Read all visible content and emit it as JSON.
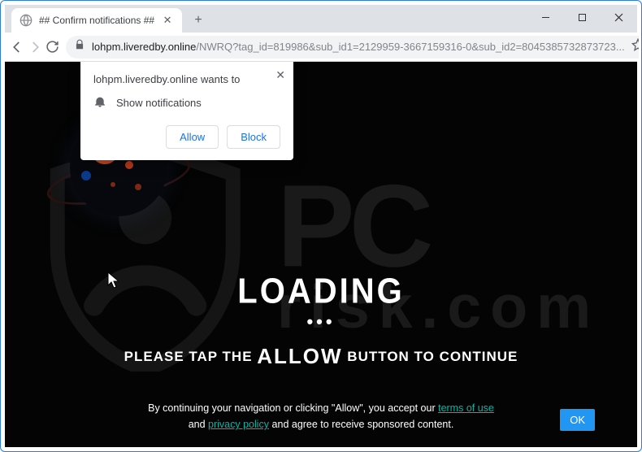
{
  "tab": {
    "title": "## Confirm notifications ##"
  },
  "url": {
    "host": "lohpm.liveredby.online",
    "path": "/NWRQ?tag_id=819986&sub_id1=2129959-3667159316-0&sub_id2=8045385732873723..."
  },
  "permission": {
    "origin_line": "lohpm.liveredby.online wants to",
    "capability": "Show notifications",
    "allow": "Allow",
    "block": "Block"
  },
  "page": {
    "loading": "LOADING",
    "dots": "•••",
    "please_pre": "PLEASE TAP THE ",
    "please_allow": "ALLOW",
    "please_post": " BUTTON TO CONTINUE"
  },
  "footer": {
    "line1_pre": "By continuing your navigation or clicking \"Allow\", you accept our ",
    "terms": "terms of use",
    "line2_pre": "and ",
    "privacy": "privacy policy",
    "line2_post": " and agree to receive sponsored content.",
    "ok": "OK"
  },
  "watermark": {
    "pc": "PC",
    "risk": "risk",
    "dot": ".",
    "com": "com"
  }
}
